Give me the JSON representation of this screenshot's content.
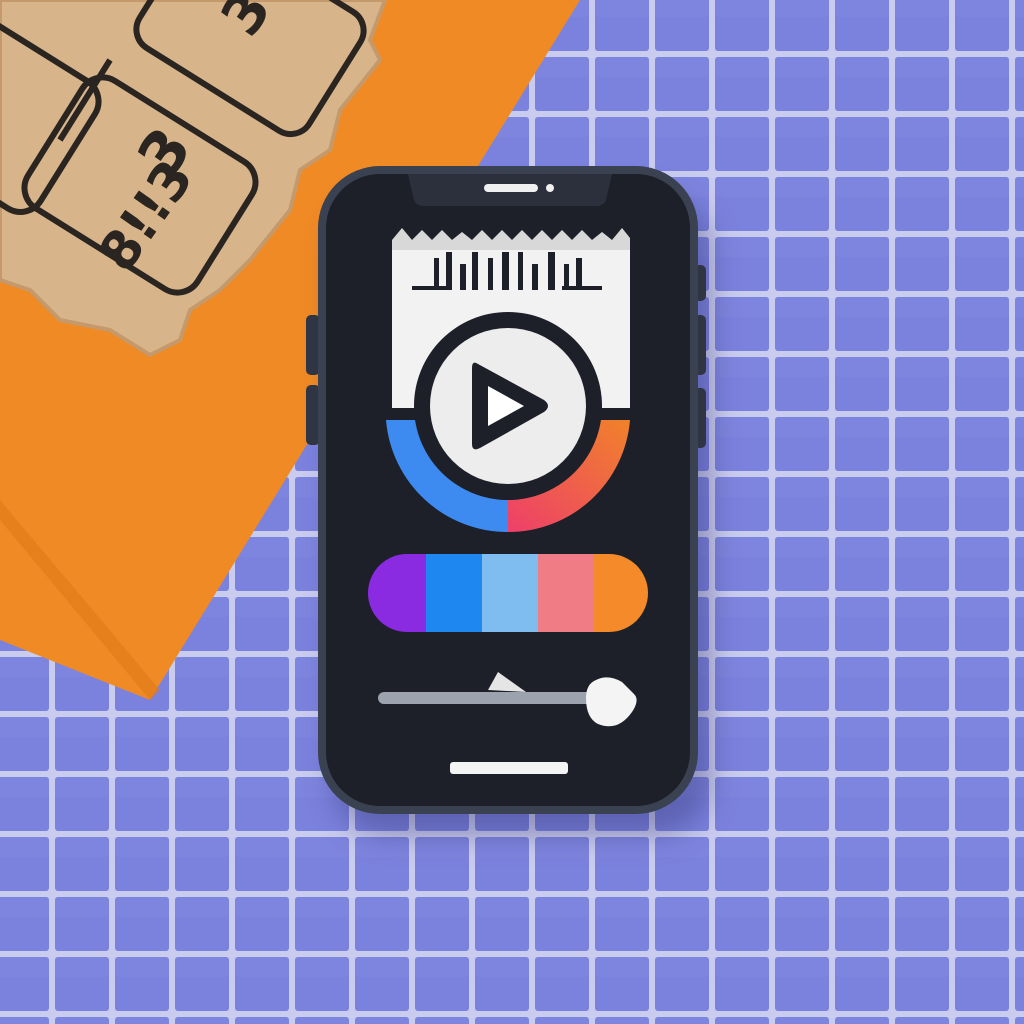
{
  "scene": {
    "description_colors": {
      "tile_fill": "#7b82dd",
      "grout": "#c9ccef",
      "paper": "#f08a24",
      "ticket": "#d8b48a",
      "phone_frame": "#3a4150",
      "screen": "#1d2028",
      "ticket_white": "#f2f2f2"
    }
  },
  "ticket_stub": {
    "printed_chars": [
      "8!!3",
      "3",
      "3",
      "3"
    ]
  },
  "player": {
    "play_icon": "play-icon",
    "ring_colors": [
      "#3d8bf0",
      "#ee4466",
      "#f07a2a"
    ],
    "color_bar": [
      "#8a2be2",
      "#1e88f0",
      "#7fbcf0",
      "#f07c86",
      "#f58a2a"
    ],
    "progress": 0.82,
    "home_indicator": "home-indicator"
  }
}
